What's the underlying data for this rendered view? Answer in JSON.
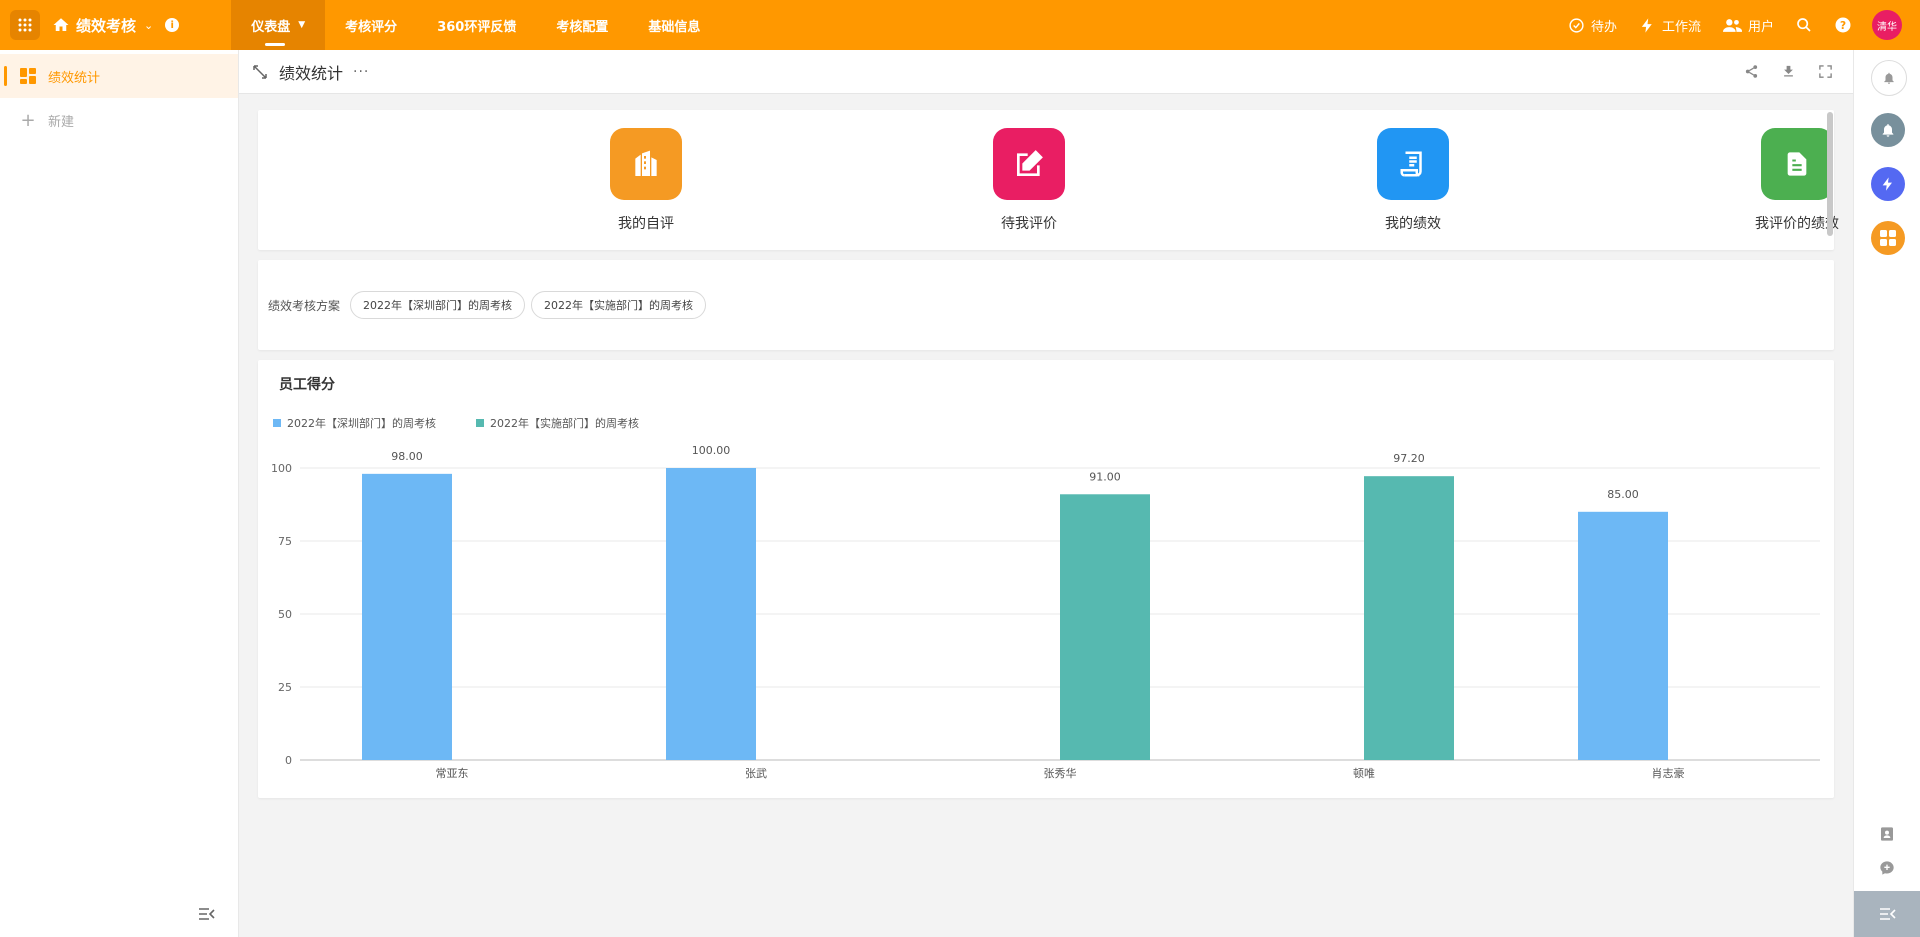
{
  "topbar": {
    "app_title": "绩效考核",
    "nav": [
      "仪表盘",
      "考核评分",
      "360环评反馈",
      "考核配置",
      "基础信息"
    ],
    "todo": "待办",
    "workflow": "工作流",
    "users": "用户",
    "avatar_text": "清华",
    "brand_color": "#ff9800"
  },
  "sidebar": {
    "items": [
      {
        "label": "绩效统计",
        "icon": "dashboard-icon"
      },
      {
        "label": "新建",
        "icon": "plus-icon"
      }
    ]
  },
  "page": {
    "title": "绩效统计"
  },
  "shortcuts": [
    {
      "label": "我的自评",
      "color": "#f59a23",
      "icon": "building-icon"
    },
    {
      "label": "待我评价",
      "color": "#e91e63",
      "icon": "edit-icon"
    },
    {
      "label": "我的绩效",
      "color": "#2196f3",
      "icon": "receipt-icon"
    },
    {
      "label": "我评价的绩效",
      "color": "#4caf50",
      "icon": "document-icon"
    }
  ],
  "filter": {
    "label": "绩效考核方案",
    "chips": [
      "2022年【深圳部门】的周考核",
      "2022年【实施部门】的周考核"
    ]
  },
  "chart_data": {
    "type": "bar",
    "title": "员工得分",
    "categories": [
      "常亚东",
      "张武",
      "张秀华",
      "顿唯",
      "肖志豪"
    ],
    "series": [
      {
        "name": "2022年【深圳部门】的周考核",
        "color": "#6db8f5",
        "values": [
          98.0,
          100.0,
          null,
          null,
          85.0
        ]
      },
      {
        "name": "2022年【实施部门】的周考核",
        "color": "#56b9b0",
        "values": [
          null,
          null,
          91.0,
          97.2,
          null
        ]
      }
    ],
    "ylim": [
      0,
      100
    ],
    "yticks": [
      0,
      25,
      50,
      75,
      100
    ],
    "grid": true,
    "legend_position": "top-left",
    "data_labels": true
  }
}
